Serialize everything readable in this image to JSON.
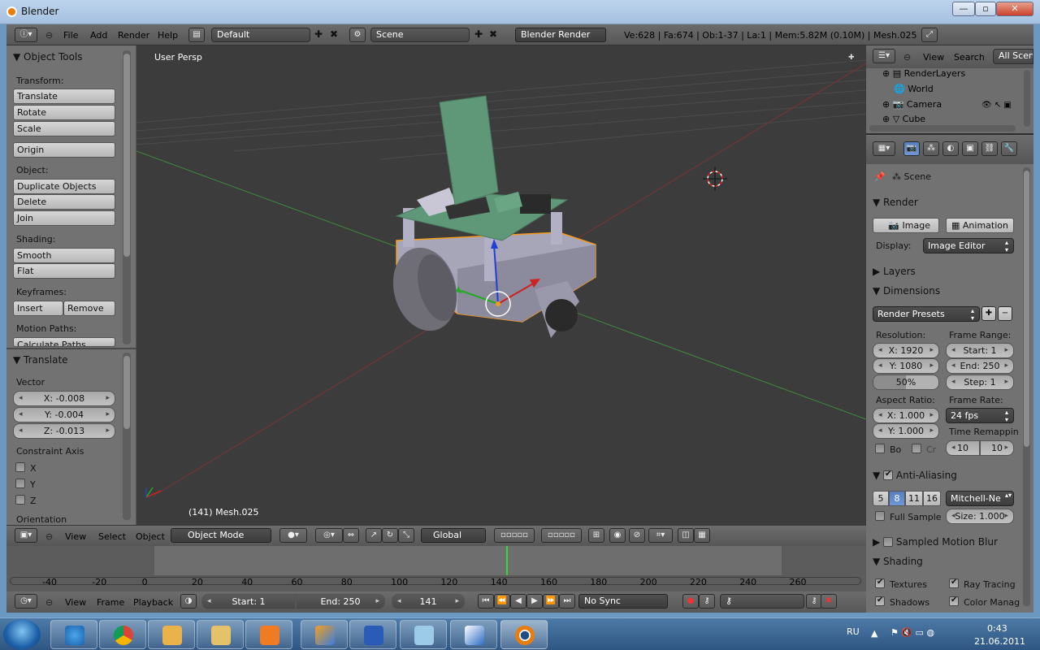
{
  "window": {
    "title": "Blender",
    "minimize": "—",
    "maximize": "▫",
    "close": "✕"
  },
  "topbar": {
    "menus": [
      "File",
      "Add",
      "Render",
      "Help"
    ],
    "layout": "Default",
    "scene": "Scene",
    "engine": "Blender Render",
    "stats": "Ve:628 | Fa:674 | Ob:1-37 | La:1 | Mem:5.82M (0.10M) | Mesh.025"
  },
  "toolshelf": {
    "title": "Object Tools",
    "transform_label": "Transform:",
    "translate": "Translate",
    "rotate": "Rotate",
    "scale": "Scale",
    "origin": "Origin",
    "object_label": "Object:",
    "duplicate": "Duplicate Objects",
    "delete": "Delete",
    "join": "Join",
    "shading_label": "Shading:",
    "smooth": "Smooth",
    "flat": "Flat",
    "keyframes_label": "Keyframes:",
    "insert": "Insert",
    "remove": "Remove",
    "motion_paths_label": "Motion Paths:",
    "calc_paths": "Calculate Paths"
  },
  "operator": {
    "title": "Translate",
    "vector_label": "Vector",
    "x": "X: -0.008",
    "y": "Y: -0.004",
    "z": "Z: -0.013",
    "constraint_label": "Constraint Axis",
    "cx": "X",
    "cy": "Y",
    "cz": "Z",
    "orientation_label": "Orientation"
  },
  "viewport": {
    "view_name": "User Persp",
    "object_label": "(141) Mesh.025",
    "colors": {
      "bg": "#3c3c3c",
      "body": "#a7a5b8",
      "deck": "#5f9878",
      "select": "#f59a1e"
    }
  },
  "vpheader": {
    "view": "View",
    "select": "Select",
    "object": "Object",
    "mode": "Object Mode",
    "orientation": "Global"
  },
  "timeline": {
    "ticks": [
      "-40",
      "-20",
      "0",
      "20",
      "40",
      "60",
      "80",
      "100",
      "120",
      "140",
      "160",
      "180",
      "200",
      "220",
      "240",
      "260"
    ],
    "current_frame": 141,
    "view": "View",
    "frame": "Frame",
    "playback": "Playback",
    "start": "Start: 1",
    "end": "End: 250",
    "current": "141",
    "sync": "No Sync"
  },
  "outliner": {
    "view": "View",
    "search": "Search",
    "scope": "All Scene",
    "items": [
      "RenderLayers",
      "World",
      "Camera",
      "Cube"
    ]
  },
  "properties": {
    "scene": "Scene",
    "render_title": "Render",
    "image_btn": "Image",
    "animation_btn": "Animation",
    "display_label": "Display:",
    "display_value": "Image Editor",
    "layers_title": "Layers",
    "dimensions_title": "Dimensions",
    "presets": "Render Presets",
    "resolution_label": "Resolution:",
    "res_x": "X: 1920",
    "res_y": "Y: 1080",
    "res_pct": "50%",
    "frame_range_label": "Frame Range:",
    "start": "Start: 1",
    "end": "End: 250",
    "step": "Step: 1",
    "aspect_label": "Aspect Ratio:",
    "asp_x": "X: 1.000",
    "asp_y": "Y: 1.000",
    "frame_rate_label": "Frame Rate:",
    "fps": "24 fps",
    "time_remap_label": "Time Remappin",
    "remap_old": "10",
    "remap_new": "10",
    "bo": "Bo",
    "cr": "Cr",
    "aa_title": "Anti-Aliasing",
    "aa_samples": [
      "5",
      "8",
      "11",
      "16"
    ],
    "aa_filter": "Mitchell-Ne",
    "full_sample": "Full Sample",
    "filter_size": "Size: 1.000",
    "motion_blur_title": "Sampled Motion Blur",
    "shading_title": "Shading",
    "textures": "Textures",
    "ray_tracing": "Ray Tracing",
    "shadows": "Shadows",
    "color_manag": "Color Manag"
  },
  "taskbar": {
    "lang": "RU",
    "time": "0:43",
    "date": "21.06.2011"
  }
}
